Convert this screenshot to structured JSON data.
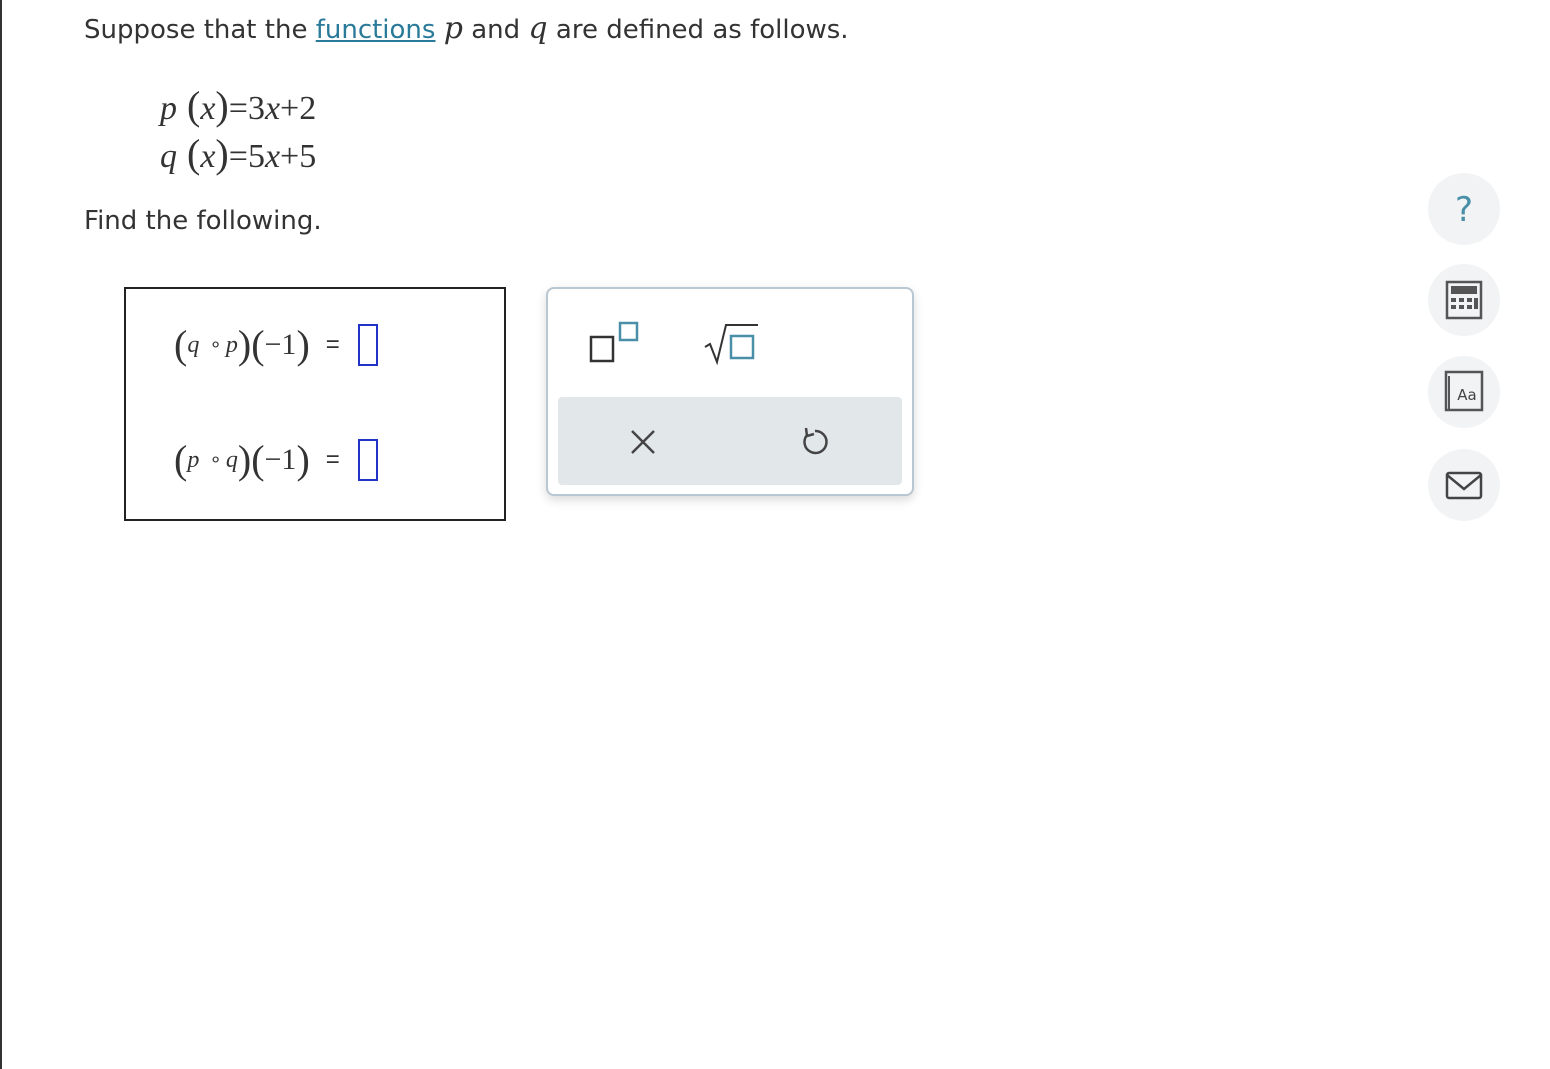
{
  "intro": {
    "text_before": "Suppose that the ",
    "link": "functions",
    "var_p": "p",
    "text_and": " and ",
    "var_q": "q",
    "text_after": " are defined as follows."
  },
  "definitions": [
    {
      "name": "p",
      "arg": "x",
      "rhs_coef": "3",
      "rhs_var": "x",
      "rhs_op": "+",
      "rhs_const": "2"
    },
    {
      "name": "q",
      "arg": "x",
      "rhs_coef": "5",
      "rhs_var": "x",
      "rhs_op": "+",
      "rhs_const": "5"
    }
  ],
  "find_text": "Find the following.",
  "questions": [
    {
      "outer": "q",
      "compose": "∘",
      "inner": "p",
      "arg": "−1",
      "equals": "=",
      "answer": ""
    },
    {
      "outer": "p",
      "compose": "∘",
      "inner": "q",
      "arg": "−1",
      "equals": "=",
      "answer": ""
    }
  ],
  "toolbox": {
    "buttons": [
      "superscript-icon",
      "square-root-icon",
      "clear-icon",
      "undo-icon"
    ]
  },
  "side_tools": {
    "help_symbol": "?",
    "reference_text": "Aa",
    "icons": [
      "help-icon",
      "calculator-icon",
      "reference-icon",
      "message-icon"
    ]
  },
  "colors": {
    "text": "#333333",
    "link": "#2a7a9a",
    "input_border": "#2234c8",
    "icon_teal": "#4a8fa8",
    "toolbar_bg": "#e2e7ea"
  }
}
